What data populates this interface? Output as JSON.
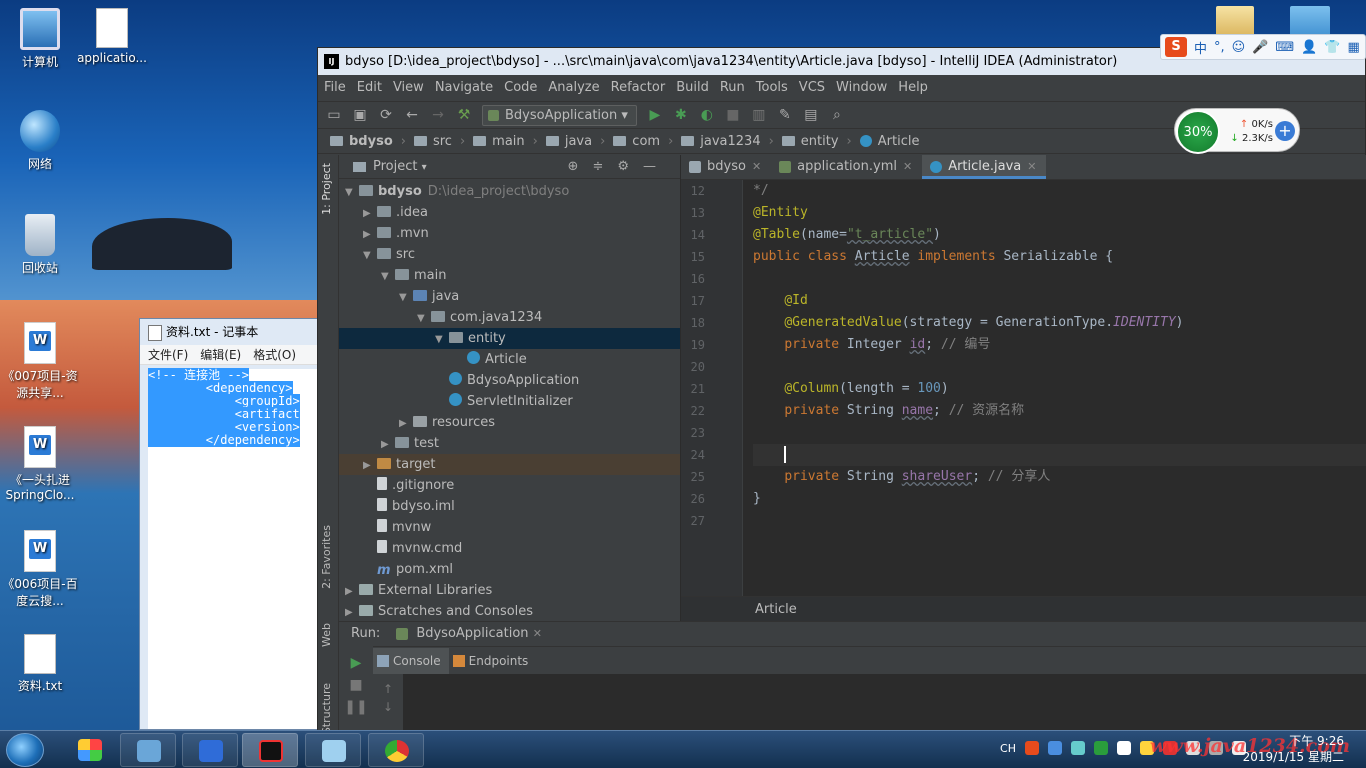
{
  "desktop": {
    "icons": [
      {
        "label": "计算机",
        "kind": "pc"
      },
      {
        "label": "applicatio...",
        "kind": "file"
      },
      {
        "label": "网络",
        "kind": "net"
      },
      {
        "label": "回收站",
        "kind": "bin"
      },
      {
        "label": "《007项目-资源共享...",
        "kind": "doc"
      },
      {
        "label": "《一头扎进SpringClo...",
        "kind": "doc"
      },
      {
        "label": "《006项目-百度云搜...",
        "kind": "doc"
      },
      {
        "label": "资料.txt",
        "kind": "file"
      }
    ]
  },
  "notepad": {
    "title": "资料.txt - 记事本",
    "menu": [
      "文件(F)",
      "编辑(E)",
      "格式(O)"
    ],
    "lines": [
      "<!-- 连接池 -->",
      "        <dependency>",
      "            <groupId>",
      "            <artifact",
      "            <version>",
      "        </dependency>"
    ]
  },
  "ide": {
    "title": "bdyso [D:\\idea_project\\bdyso] - ...\\src\\main\\java\\com\\java1234\\entity\\Article.java [bdyso] - IntelliJ IDEA (Administrator)",
    "menu": [
      "File",
      "Edit",
      "View",
      "Navigate",
      "Code",
      "Analyze",
      "Refactor",
      "Build",
      "Run",
      "Tools",
      "VCS",
      "Window",
      "Help"
    ],
    "run_config": "BdysoApplication",
    "breadcrumb": [
      "bdyso",
      "src",
      "main",
      "java",
      "com",
      "java1234",
      "entity",
      "Article"
    ],
    "left_tabs": {
      "project": "1: Project",
      "favorites": "2: Favorites",
      "web": "Web",
      "structure": "Structure"
    },
    "project_header": "Project",
    "tree": [
      {
        "label": "bdyso",
        "extra": "D:\\idea_project\\bdyso",
        "depth": 0,
        "arrow": "▼",
        "icon": "fic",
        "bold": true
      },
      {
        "label": ".idea",
        "depth": 1,
        "arrow": "▶",
        "icon": "fic"
      },
      {
        "label": ".mvn",
        "depth": 1,
        "arrow": "▶",
        "icon": "fic"
      },
      {
        "label": "src",
        "depth": 1,
        "arrow": "▼",
        "icon": "fic"
      },
      {
        "label": "main",
        "depth": 2,
        "arrow": "▼",
        "icon": "fic"
      },
      {
        "label": "java",
        "depth": 3,
        "arrow": "▼",
        "icon": "fic src"
      },
      {
        "label": "com.java1234",
        "depth": 4,
        "arrow": "▼",
        "icon": "fic"
      },
      {
        "label": "entity",
        "depth": 5,
        "arrow": "▼",
        "icon": "fic",
        "selected": true
      },
      {
        "label": "Article",
        "depth": 6,
        "arrow": "",
        "icon": "fic cls"
      },
      {
        "label": "BdysoApplication",
        "depth": 5,
        "arrow": "",
        "icon": "fic cls"
      },
      {
        "label": "ServletInitializer",
        "depth": 5,
        "arrow": "",
        "icon": "fic cls"
      },
      {
        "label": "resources",
        "depth": 3,
        "arrow": "▶",
        "icon": "fic res"
      },
      {
        "label": "test",
        "depth": 2,
        "arrow": "▶",
        "icon": "fic"
      },
      {
        "label": "target",
        "depth": 1,
        "arrow": "▶",
        "icon": "fic tgt",
        "target": true
      },
      {
        "label": ".gitignore",
        "depth": 1,
        "arrow": "",
        "icon": "fic file"
      },
      {
        "label": "bdyso.iml",
        "depth": 1,
        "arrow": "",
        "icon": "fic file"
      },
      {
        "label": "mvnw",
        "depth": 1,
        "arrow": "",
        "icon": "fic file"
      },
      {
        "label": "mvnw.cmd",
        "depth": 1,
        "arrow": "",
        "icon": "fic file"
      },
      {
        "label": "pom.xml",
        "depth": 1,
        "arrow": "",
        "icon": "fic mvn"
      },
      {
        "label": "External Libraries",
        "depth": 0,
        "arrow": "▶",
        "icon": "fic lib"
      },
      {
        "label": "Scratches and Consoles",
        "depth": 0,
        "arrow": "▶",
        "icon": "fic lib"
      }
    ],
    "tabs": [
      {
        "label": "bdyso",
        "kind": "mvn"
      },
      {
        "label": "application.yml",
        "kind": "yml"
      },
      {
        "label": "Article.java",
        "kind": "cls",
        "active": true
      }
    ],
    "code_lines": [
      {
        "n": "12",
        "html": "<span class=\"cm\">*/</span>"
      },
      {
        "n": "13",
        "html": "<span class=\"an\">@Entity</span>"
      },
      {
        "n": "14",
        "html": "<span class=\"an\">@Table</span>(name=<span class=\"st ul\">\"t_article\"</span>)"
      },
      {
        "n": "15",
        "html": "<span class=\"kw\">public class</span> <span class=\"ul\">Article</span> <span class=\"kw\">implements</span> Serializable {"
      },
      {
        "n": "16",
        "html": ""
      },
      {
        "n": "17",
        "html": "    <span class=\"an\">@Id</span>"
      },
      {
        "n": "18",
        "html": "    <span class=\"an\">@GeneratedValue</span>(strategy = GenerationType.<span class=\"it\">IDENTITY</span>)"
      },
      {
        "n": "19",
        "html": "    <span class=\"kw\">private</span> Integer <span class=\"fd ul\">id</span>; <span class=\"cm\">// 编号</span>"
      },
      {
        "n": "20",
        "html": ""
      },
      {
        "n": "21",
        "html": "    <span class=\"an\">@Column</span>(length = <span class=\"nu\">100</span>)"
      },
      {
        "n": "22",
        "html": "    <span class=\"kw\">private</span> String <span class=\"fd ul\">name</span>; <span class=\"cm\">// 资源名称</span>"
      },
      {
        "n": "23",
        "html": ""
      },
      {
        "n": "24",
        "html": "    <span class=\"caret\"></span>",
        "current": true
      },
      {
        "n": "25",
        "html": "    <span class=\"kw\">private</span> String <span class=\"fd ul\">shareUser</span>; <span class=\"cm\">// 分享人</span>"
      },
      {
        "n": "26",
        "html": "}"
      },
      {
        "n": "27",
        "html": ""
      }
    ],
    "editor_footer": "Article",
    "run_label": "Run:",
    "run_config_tab": "BdysoApplication",
    "run_tabs": [
      "Console",
      "Endpoints"
    ]
  },
  "ime": {
    "logo": "S",
    "items": [
      "中",
      "°,",
      "☺",
      "🎤",
      "⌨",
      "👤",
      "👕",
      "▦"
    ]
  },
  "netspeed": {
    "percent": "30%",
    "up": "0K/s",
    "down": "2.3K/s"
  },
  "taskbar": {
    "tray": [
      "CH"
    ],
    "time": "下午 9:26",
    "date": "2019/1/15 星期二",
    "watermark": "www.java1234.com"
  }
}
